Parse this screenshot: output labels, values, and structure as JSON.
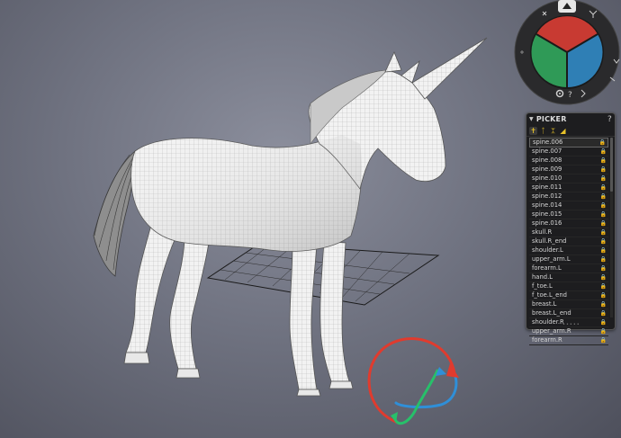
{
  "viewport": {
    "subject": "unicorn-wireframe-mesh"
  },
  "pie_menu": {
    "colors": {
      "x_axis": "#c83a32",
      "y_axis": "#2f9a57",
      "z_axis": "#2f7fb5"
    },
    "icons": [
      "top-view-icon",
      "axis-icon",
      "gear-icon",
      "help-icon",
      "snap-icon",
      "pin-icon"
    ],
    "help_glyph": "?"
  },
  "picker": {
    "title": "PICKER",
    "help": "?",
    "tools": [
      "bone-select-icon",
      "bone-pin-icon",
      "bone-chain-icon",
      "shape-icon"
    ],
    "bones": [
      "spine.006",
      "spine.007",
      "spine.008",
      "spine.009",
      "spine.010",
      "spine.011",
      "spine.012",
      "spine.014",
      "spine.015",
      "spine.016",
      "skull.R",
      "skull.R_end",
      "shoulder.L",
      "upper_arm.L",
      "forearm.L",
      "hand.L",
      "f_toe.L",
      "f_toe.L_end",
      "breast.L",
      "breast.L_end",
      "shoulder.R",
      "upper_arm.R",
      "forearm.R"
    ],
    "lock_glyph": "🔒"
  },
  "gizmo": {
    "colors": {
      "red": "#e03b2e",
      "blue": "#2f8fd8",
      "green": "#27c06a"
    }
  }
}
